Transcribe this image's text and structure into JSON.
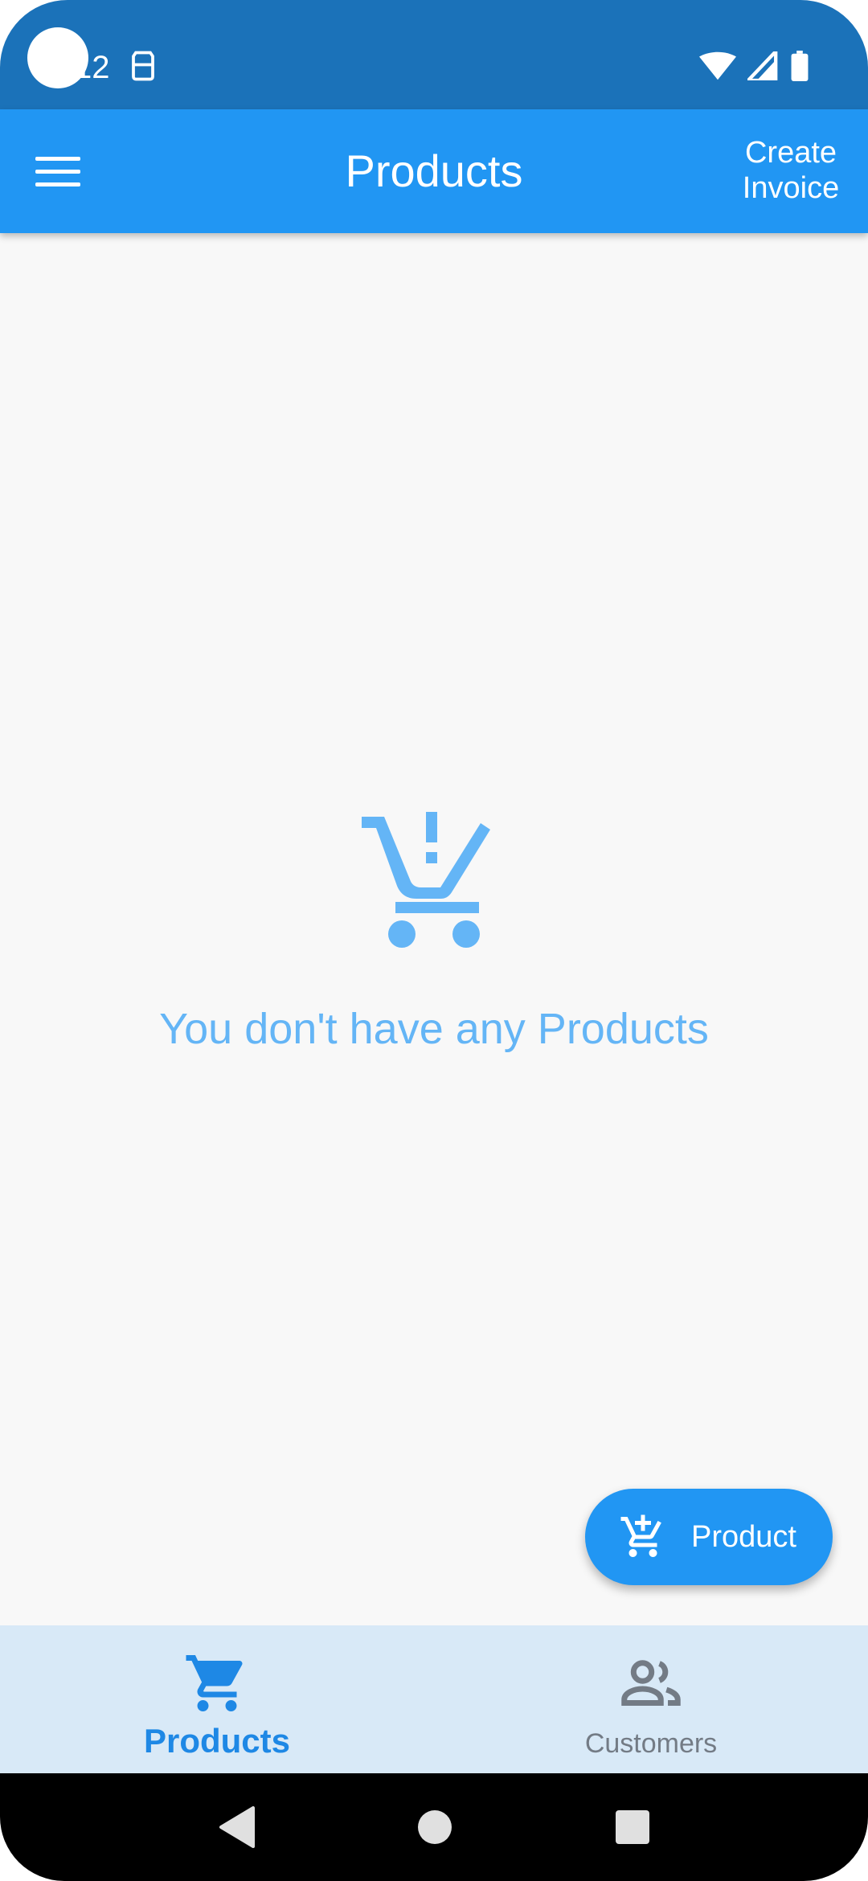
{
  "status_bar": {
    "time": "12",
    "icons": [
      "camera-dot",
      "sim-notification-icon",
      "wifi-icon",
      "cell-signal-icon",
      "battery-icon"
    ]
  },
  "app_bar": {
    "menu_icon": "hamburger-menu-icon",
    "title": "Products",
    "action_line1": "Create",
    "action_line2": "Invoice"
  },
  "empty_state": {
    "icon": "remove-shopping-cart-exclaim-icon",
    "message": "You don't have any Products"
  },
  "fab": {
    "icon": "add-shopping-cart-icon",
    "label": "Product"
  },
  "bottom_nav": {
    "items": [
      {
        "label": "Products",
        "icon": "shopping-cart-icon",
        "active": true
      },
      {
        "label": "Customers",
        "icon": "people-icon",
        "active": false
      }
    ]
  },
  "system_nav": {
    "buttons": [
      "back-icon",
      "home-icon",
      "recents-icon"
    ]
  },
  "colors": {
    "status_bar": "#1b72b9",
    "primary": "#2196f3",
    "empty_accent": "#64b5f6",
    "nav_background": "#d8e9f7",
    "nav_active": "#1e88e5",
    "nav_inactive": "#737b85"
  }
}
